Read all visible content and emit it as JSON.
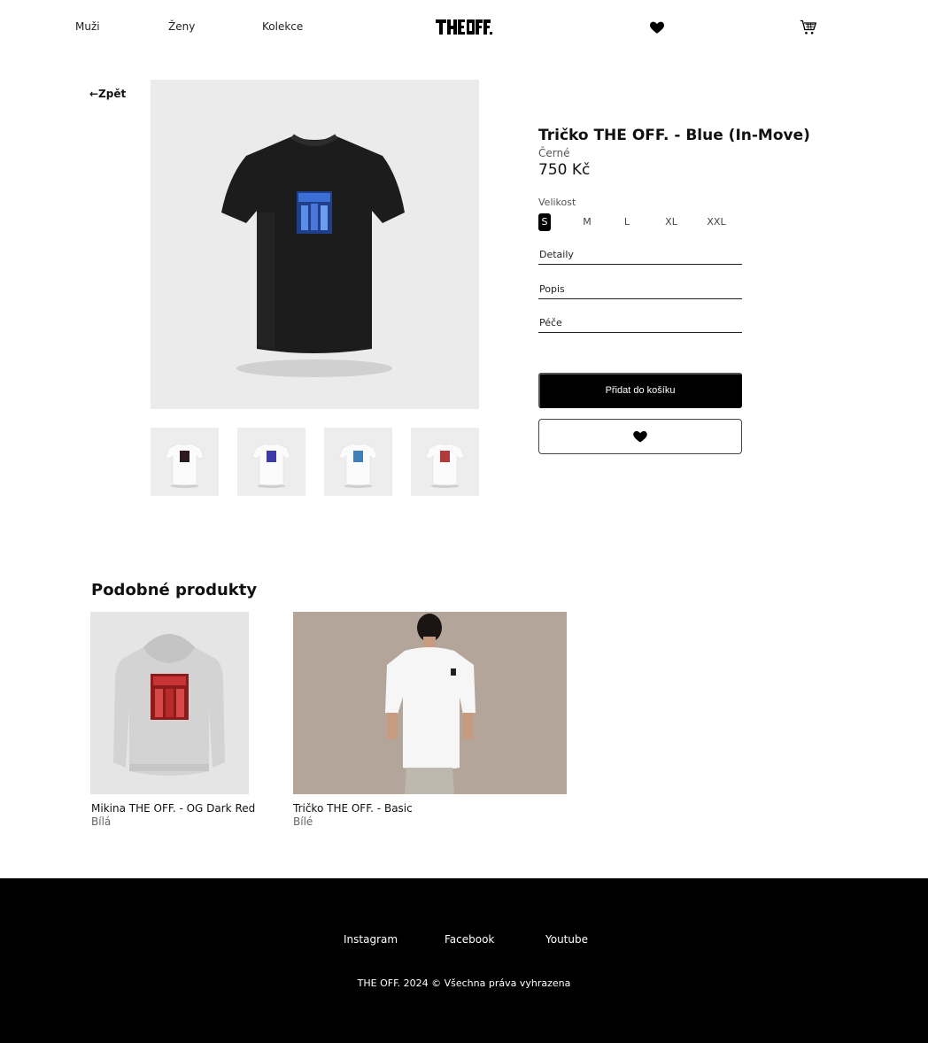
{
  "header": {
    "nav": [
      "Muži",
      "Ženy",
      "Kolekce"
    ],
    "logo_text": "THE OFF.",
    "icons": [
      "heart-icon",
      "cart-icon"
    ]
  },
  "back_label": "←Zpět",
  "product": {
    "title": "Tričko THE OFF. - Blue (In-Move)",
    "color": "Černé",
    "price": "750 Kč",
    "size_label": "Velikost",
    "sizes": [
      "S",
      "M",
      "L",
      "XL",
      "XXL"
    ],
    "selected_size": "S",
    "accordions": [
      "Detaily",
      "Popis",
      "Péče"
    ],
    "add_to_cart": "Přidat do košíku",
    "thumbnail_print_colors": [
      "#2a1a24",
      "#3b3aa8",
      "#3f7fb8",
      "#b23a3a"
    ]
  },
  "similar": {
    "title": "Podobné produkty",
    "items": [
      {
        "name": "Mikina THE OFF. - OG Dark Red",
        "color": "Bílá"
      },
      {
        "name": "Tričko THE OFF. - Basic",
        "color": "Bílé"
      }
    ]
  },
  "footer": {
    "links": [
      "Instagram",
      "Facebook",
      "Youtube"
    ],
    "copyright": "THE OFF. 2024 © Všechna práva vyhrazena"
  },
  "colors": {
    "primary": "#000000",
    "image_bg": "#ebebeb",
    "hoodie_print": "#9b1c1c",
    "lifestyle_bg": "#b3a59a"
  }
}
